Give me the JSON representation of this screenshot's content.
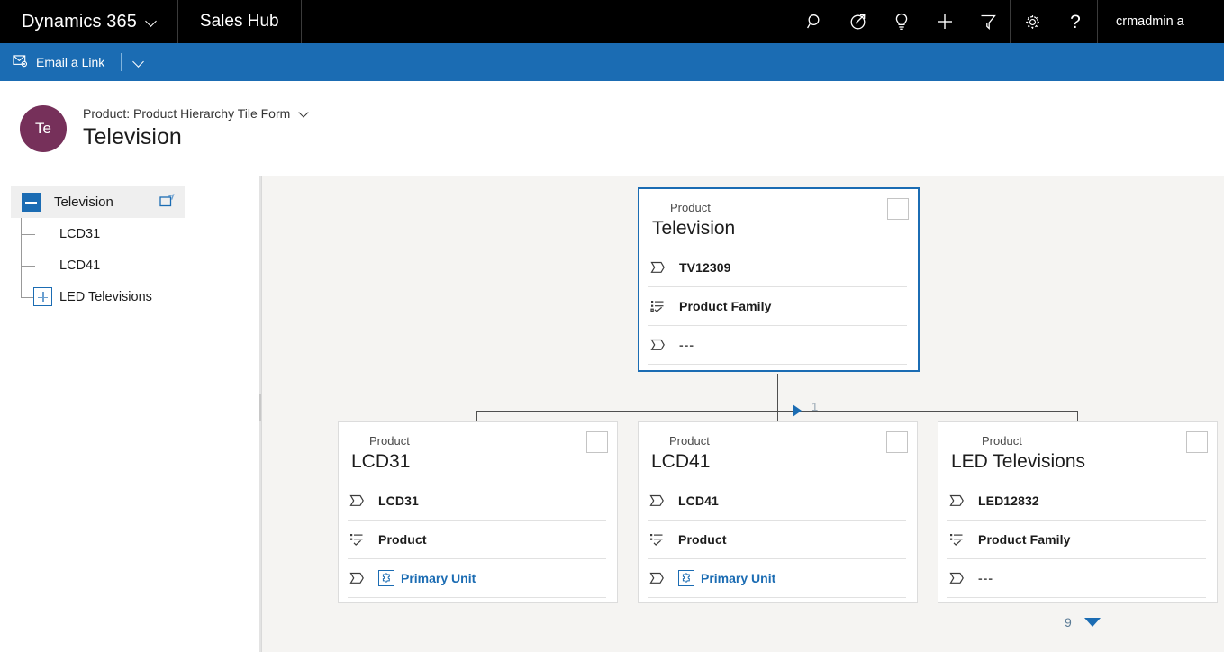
{
  "topbar": {
    "brand": "Dynamics 365",
    "brand_chevron_icon": "chevron-down-icon",
    "app_title": "Sales Hub",
    "icons": [
      {
        "name": "search-icon",
        "label": "Search"
      },
      {
        "name": "assistant-icon",
        "label": "Relationship assistant"
      },
      {
        "name": "lightbulb-icon",
        "label": "Insights"
      },
      {
        "name": "plus-icon",
        "label": "Quick create"
      },
      {
        "name": "filter-icon",
        "label": "Filter"
      }
    ],
    "settings_icon": "gear-icon",
    "help_icon": "help-icon",
    "user": "crmadmin a"
  },
  "commandbar": {
    "email_link_icon": "email-link-icon",
    "email_link_label": "Email a Link",
    "overflow_icon": "chevron-down-icon",
    "background_color": "#1b6cb3"
  },
  "record_header": {
    "avatar_initials": "Te",
    "avatar_color": "#76305a",
    "form_label": "Product: Product Hierarchy Tile Form",
    "form_chevron_icon": "chevron-down-icon",
    "title": "Television"
  },
  "sidebar": {
    "root": {
      "label": "Television",
      "toggle_icon": "collapse-minus-icon",
      "expanded": true,
      "popout_icon": "open-in-new-window-icon"
    },
    "children": [
      {
        "label": "LCD31",
        "toggle_icon": "none",
        "expandable": false
      },
      {
        "label": "LCD41",
        "toggle_icon": "none",
        "expandable": false
      },
      {
        "label": "LED Televisions",
        "toggle_icon": "expand-plus-icon",
        "expandable": true
      }
    ]
  },
  "hierarchy": {
    "accent_color": "#1b6cb3",
    "parent_card": {
      "kind": "Product",
      "title": "Television",
      "selected": true,
      "checkbox_checked": false,
      "rows": [
        {
          "icon": "text-field-icon",
          "value": "TV12309",
          "type": "text"
        },
        {
          "icon": "optionset-icon",
          "value": "Product Family",
          "type": "text"
        },
        {
          "icon": "text-field-icon",
          "value": "---",
          "type": "empty"
        }
      ]
    },
    "child_cards": [
      {
        "kind": "Product",
        "title": "LCD31",
        "selected": false,
        "checkbox_checked": false,
        "rows": [
          {
            "icon": "text-field-icon",
            "value": "LCD31",
            "type": "text"
          },
          {
            "icon": "optionset-icon",
            "value": "Product",
            "type": "text"
          },
          {
            "icon": "text-field-icon",
            "value": "Primary Unit",
            "type": "link",
            "link_icon": "entity-puzzle-icon"
          }
        ]
      },
      {
        "kind": "Product",
        "title": "LCD41",
        "selected": false,
        "checkbox_checked": false,
        "rows": [
          {
            "icon": "text-field-icon",
            "value": "LCD41",
            "type": "text"
          },
          {
            "icon": "optionset-icon",
            "value": "Product",
            "type": "text"
          },
          {
            "icon": "text-field-icon",
            "value": "Primary Unit",
            "type": "link",
            "link_icon": "entity-puzzle-icon"
          }
        ]
      },
      {
        "kind": "Product",
        "title": "LED Televisions",
        "selected": false,
        "checkbox_checked": false,
        "rows": [
          {
            "icon": "text-field-icon",
            "value": "LED12832",
            "type": "text"
          },
          {
            "icon": "optionset-icon",
            "value": "Product Family",
            "type": "text"
          },
          {
            "icon": "text-field-icon",
            "value": "---",
            "type": "empty"
          }
        ]
      }
    ],
    "connector_marker_icon": "play-triangle-icon",
    "connector_count": "1"
  },
  "pager": {
    "count": "9",
    "arrow_icon": "chevron-down-filled-icon"
  }
}
